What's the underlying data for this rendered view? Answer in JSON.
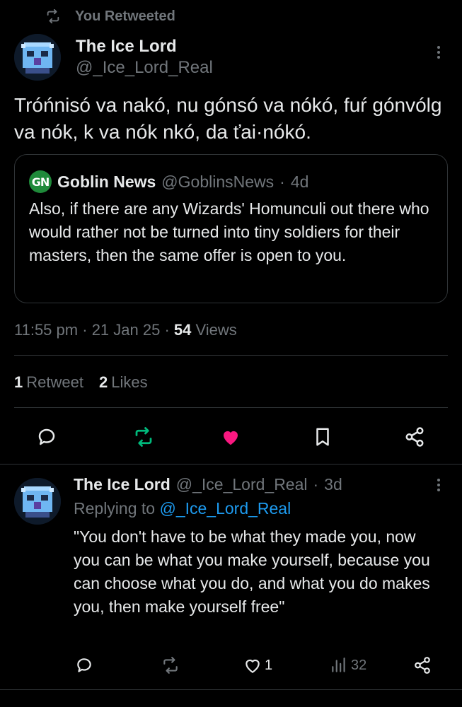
{
  "retweet_header": {
    "icon": "retweet-icon",
    "label": "You Retweeted"
  },
  "tweet": {
    "author_name": "The Ice Lord",
    "author_handle": "@_Ice_Lord_Real",
    "text": "Tróńnisó va nakó, nu gónsó va nókó, fuŕ gónvólg va nók, k va nók nkó, da ťai·nókó.",
    "quote": {
      "logo_text": "GN",
      "author_name": "Goblin News",
      "author_handle": "@GoblinsNews",
      "separator": "·",
      "age": "4d",
      "text": "Also, if there are any Wizards' Homunculi out there who would rather not be turned into tiny soldiers for their masters, then the same offer is open to you."
    },
    "time": "11:55 pm",
    "dot1": "·",
    "date": "21 Jan 25",
    "dot2": "·",
    "views_count": "54",
    "views_label": "Views",
    "retweets_count": "1",
    "retweets_label": "Retweet",
    "likes_count": "2",
    "likes_label": "Likes",
    "actions": [
      "reply-icon",
      "retweet-icon",
      "like-icon",
      "bookmark-icon",
      "share-icon"
    ],
    "colors": {
      "retweet_active": "#00ba7c",
      "like_active": "#f91880"
    }
  },
  "reply": {
    "author_name": "The Ice Lord",
    "author_handle": "@_Ice_Lord_Real",
    "separator": "·",
    "age": "3d",
    "replying_prefix": "Replying to",
    "replying_to": "@_Ice_Lord_Real",
    "text": "\"You don't have to be what they made you, now you can be what you make yourself, because you can choose what you do, and what you do makes you, then make yourself free\"",
    "likes_count": "1",
    "views_count": "32"
  }
}
